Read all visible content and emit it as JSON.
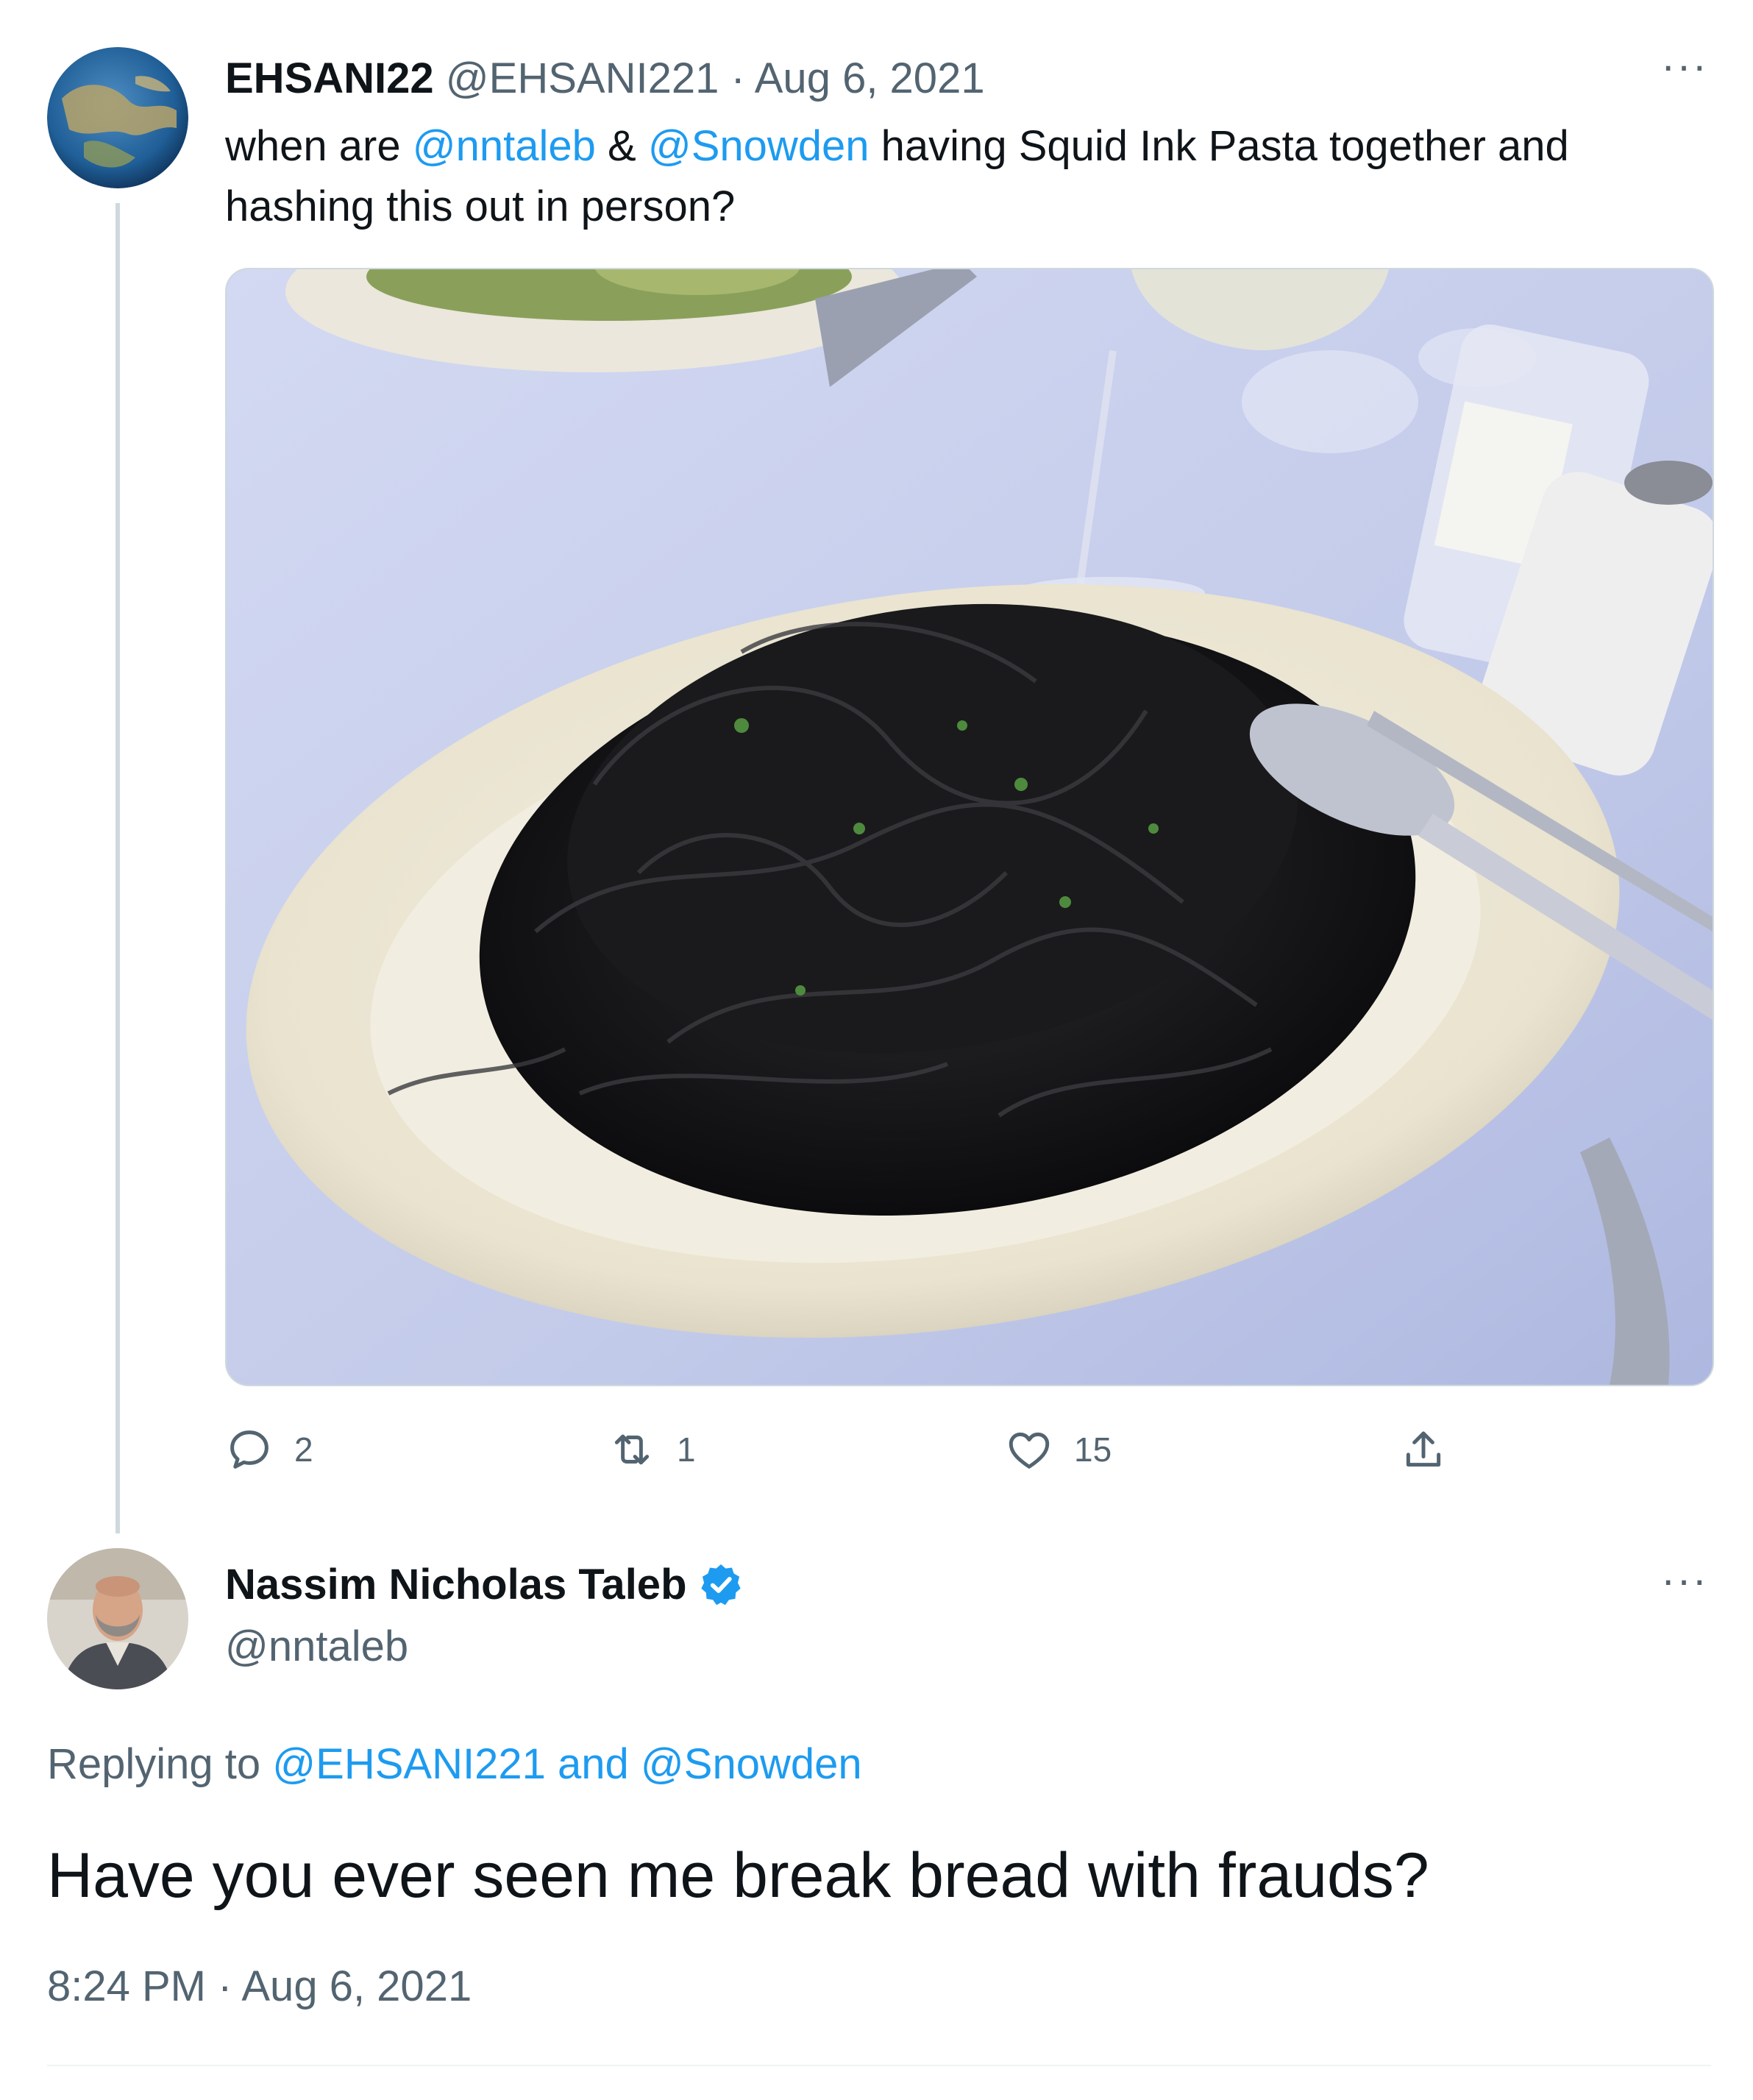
{
  "tweet": {
    "author_name": "EHSANI22",
    "handle": "@EHSANI221",
    "separator": "·",
    "date": "Aug 6, 2021",
    "text_before": "when are ",
    "mention_1": "@nntaleb",
    "text_amp": " & ",
    "mention_2": "@Snowden",
    "text_after": " having Squid Ink Pasta together and hashing this out in person?",
    "more_label": "···",
    "media_alt": "Squid ink pasta",
    "actions": {
      "reply_count": "2",
      "retweet_count": "1",
      "like_count": "15"
    }
  },
  "reply": {
    "author_name": "Nassim Nicholas Taleb",
    "handle": "@nntaleb",
    "more_label": "···",
    "replying_prefix": "Replying to ",
    "replying_mention_1": "@EHSANI221",
    "replying_and": " and ",
    "replying_mention_2": "@Snowden",
    "text": "Have you ever seen me break bread with frauds?",
    "time": "8:24 PM",
    "separator": "·",
    "date": "Aug 6, 2021"
  },
  "colors": {
    "accent": "#1d9bf0",
    "muted": "#536471",
    "text": "#0f1419",
    "divider": "#cfd9de"
  },
  "icons": [
    "globe-avatar",
    "reply-icon",
    "retweet-icon",
    "like-icon",
    "share-icon",
    "verified-badge-icon",
    "more-icon"
  ]
}
